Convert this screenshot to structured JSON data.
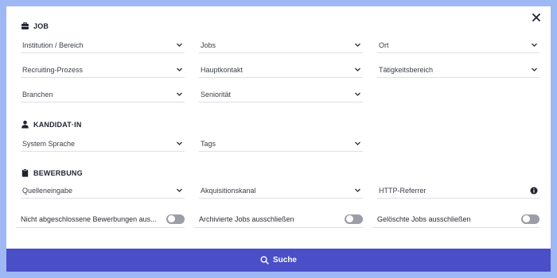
{
  "colors": {
    "background": "#9db8f5",
    "panel": "#ffffff",
    "accent": "#4a4ec7",
    "toggle_off": "#9b9ea6"
  },
  "sections": {
    "job": {
      "title": "JOB",
      "icon": "briefcase-icon"
    },
    "kandidat": {
      "title": "KANDIDAT·IN",
      "icon": "person-icon"
    },
    "bewerbung": {
      "title": "BEWERBUNG",
      "icon": "clipboard-icon"
    }
  },
  "fields": {
    "institution": "Institution / Bereich",
    "jobs": "Jobs",
    "ort": "Ort",
    "recruiting": "Recruiting-Prozess",
    "hauptkontakt": "Hauptkontakt",
    "taetigkeit": "Tätigkeitsbereich",
    "branchen": "Branchen",
    "senioritaet": "Seniorität",
    "sprache": "System Sprache",
    "tags": "Tags",
    "quelle": "Quelleneingabe",
    "akquisition": "Akquisitionskanal",
    "referrer_placeholder": "HTTP-Referrer"
  },
  "toggles": {
    "nicht_abgeschlossen": {
      "label": "Nicht abgeschlossene Bewerbungen aus...",
      "on": false
    },
    "archivierte": {
      "label": "Archivierte Jobs ausschließen",
      "on": false
    },
    "geloeschte": {
      "label": "Gelöschte Jobs ausschließen",
      "on": false
    }
  },
  "search_label": "Suche"
}
